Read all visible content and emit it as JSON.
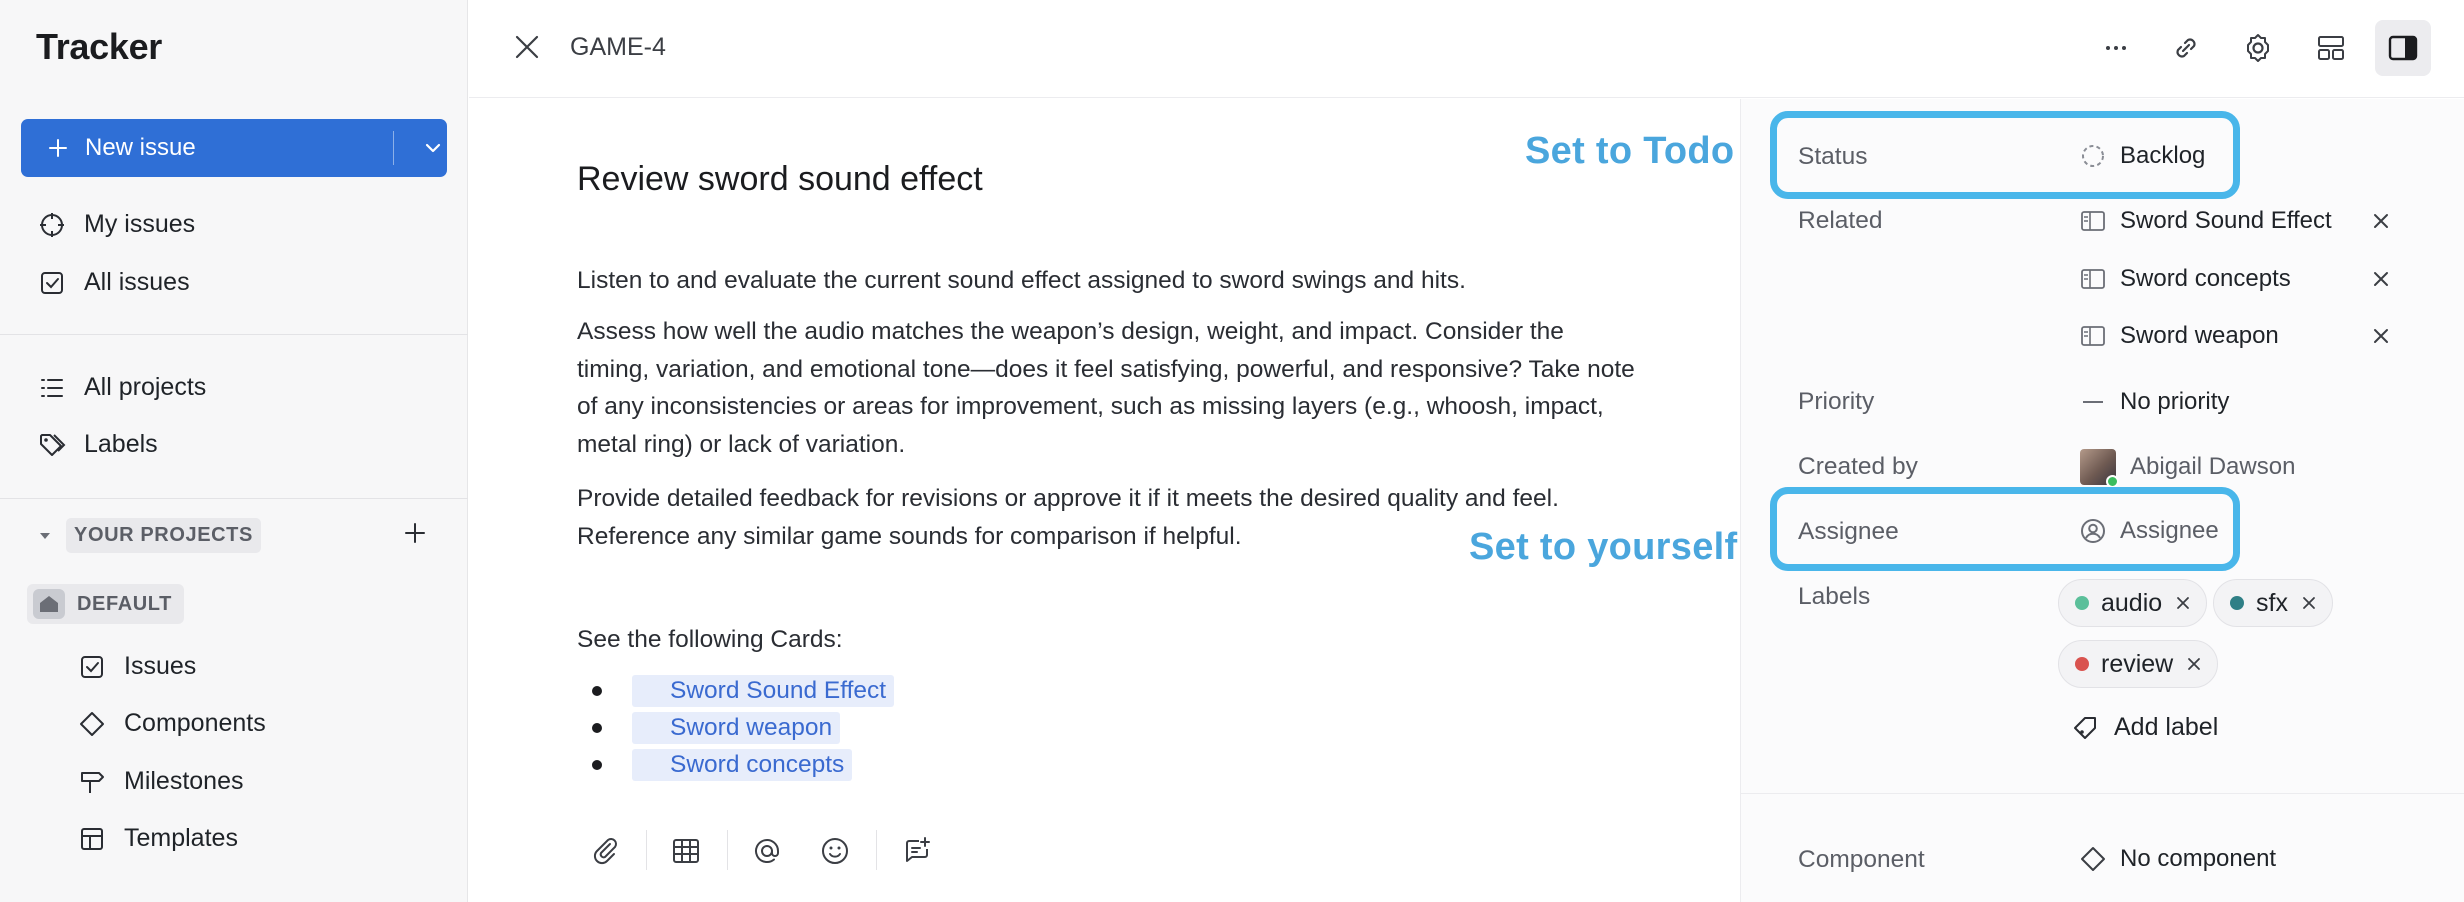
{
  "app": {
    "title": "Tracker"
  },
  "sidebar": {
    "new_issue_label": "New issue",
    "nav": [
      {
        "label": "My issues",
        "icon": "crosshair-icon"
      },
      {
        "label": "All issues",
        "icon": "checkbox-icon"
      },
      {
        "label": "All projects",
        "icon": "list-icon"
      },
      {
        "label": "Labels",
        "icon": "tags-icon"
      }
    ],
    "projects_header": "YOUR PROJECTS",
    "project_name": "DEFAULT",
    "project_items": [
      {
        "label": "Issues",
        "icon": "checkbox-icon"
      },
      {
        "label": "Components",
        "icon": "diamond-icon"
      },
      {
        "label": "Milestones",
        "icon": "signpost-icon"
      },
      {
        "label": "Templates",
        "icon": "template-icon"
      }
    ]
  },
  "header": {
    "issue_id": "GAME-4"
  },
  "issue": {
    "title": "Review sword sound effect",
    "paragraphs": [
      "Listen to and evaluate the current sound effect assigned to sword swings and hits.",
      "Assess how well the audio matches the weapon’s design, weight, and impact. Consider the timing, variation, and emotional tone—does it feel satisfying, powerful, and responsive? Take note of any inconsistencies or areas for improvement, such as missing layers (e.g., whoosh, impact, metal ring) or lack of variation.",
      "Provide detailed feedback for revisions or approve it if it meets the desired quality and feel. Reference any similar game sounds for comparison if helpful."
    ],
    "cards_label": "See the following Cards:",
    "cards": [
      "Sword Sound Effect",
      "Sword weapon",
      "Sword concepts"
    ]
  },
  "callouts": {
    "status": "Set to Todo",
    "assignee": "Set to yourself"
  },
  "panel": {
    "status": {
      "label": "Status",
      "value": "Backlog"
    },
    "related": {
      "label": "Related",
      "items": [
        "Sword Sound Effect",
        "Sword concepts",
        "Sword weapon"
      ]
    },
    "priority": {
      "label": "Priority",
      "value": "No priority"
    },
    "created_by": {
      "label": "Created by",
      "value": "Abigail Dawson"
    },
    "assignee": {
      "label": "Assignee",
      "value": "Assignee"
    },
    "labels": {
      "label": "Labels",
      "items": [
        {
          "name": "audio",
          "color": "#5bbf9a"
        },
        {
          "name": "sfx",
          "color": "#2f7f86"
        },
        {
          "name": "review",
          "color": "#d9534f"
        }
      ],
      "add_label": "Add label"
    },
    "component": {
      "label": "Component",
      "value": "No component"
    }
  },
  "colors": {
    "accent": "#2f6fd6",
    "callout": "#4aa6dd",
    "highlight": "#49b6ea"
  }
}
